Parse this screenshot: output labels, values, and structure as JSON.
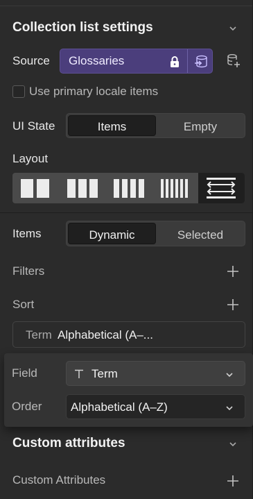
{
  "collection_list": {
    "title": "Collection list settings",
    "source_label": "Source",
    "source_value": "Glossaries",
    "use_primary_locale_label": "Use primary locale items",
    "ui_state_label": "UI State",
    "ui_state_options": [
      "Items",
      "Empty"
    ],
    "ui_state_selected": "Items",
    "layout_label": "Layout",
    "layout_options": [
      "2-columns-icon",
      "3-columns-icon",
      "4-columns-icon",
      "6-columns-icon",
      "horizontal-scroll-icon"
    ],
    "layout_selected_index": 4,
    "items_label": "Items",
    "items_options": [
      "Dynamic",
      "Selected"
    ],
    "items_selected": "Dynamic",
    "filters_label": "Filters",
    "sort_label": "Sort",
    "sort_item_field": "Term",
    "sort_item_order": "Alphabetical (A–..."
  },
  "sort_popover": {
    "field_label": "Field",
    "field_value": "Term",
    "field_icon": "text-type-icon",
    "order_label": "Order",
    "order_value": "Alphabetical (A–Z)"
  },
  "custom_attributes": {
    "title": "Custom attributes",
    "row_label": "Custom Attributes"
  },
  "colors": {
    "panel_bg": "#2b2b2b",
    "source_accent": "#4b3e7c",
    "active_segment": "#1f1f1f"
  }
}
